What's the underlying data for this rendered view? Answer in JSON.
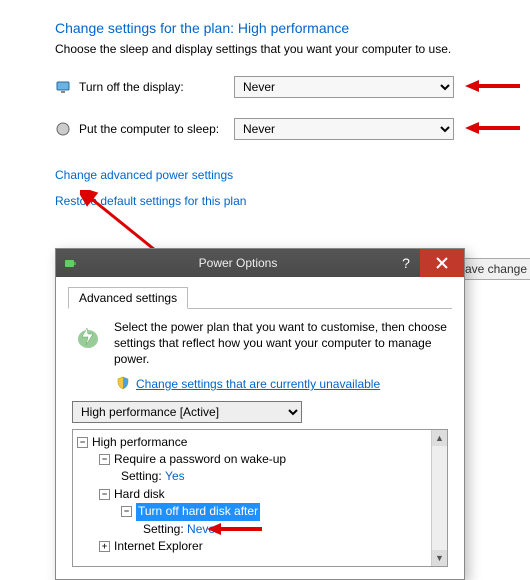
{
  "page": {
    "title": "Change settings for the plan: High performance",
    "description": "Choose the sleep and display settings that you want your computer to use.",
    "display_label": "Turn off the display:",
    "display_value": "Never",
    "sleep_label": "Put the computer to sleep:",
    "sleep_value": "Never",
    "adv_link": "Change advanced power settings",
    "restore_link": "Restore default settings for this plan",
    "save_btn": "Save change"
  },
  "dialog": {
    "title": "Power Options",
    "tab": "Advanced settings",
    "customise_text": "Select the power plan that you want to customise, then choose settings that reflect how you want your computer to manage power.",
    "shield_link": "Change settings that are currently unavailable",
    "plan_value": "High performance [Active]",
    "tree": {
      "root": "High performance",
      "wake": "Require a password on wake-up",
      "wake_setting_label": "Setting:",
      "wake_setting_value": "Yes",
      "hdd": "Hard disk",
      "hdd_off": "Turn off hard disk after",
      "hdd_setting_label": "Setting:",
      "hdd_setting_value": "Never",
      "ie": "Internet Explorer"
    }
  }
}
